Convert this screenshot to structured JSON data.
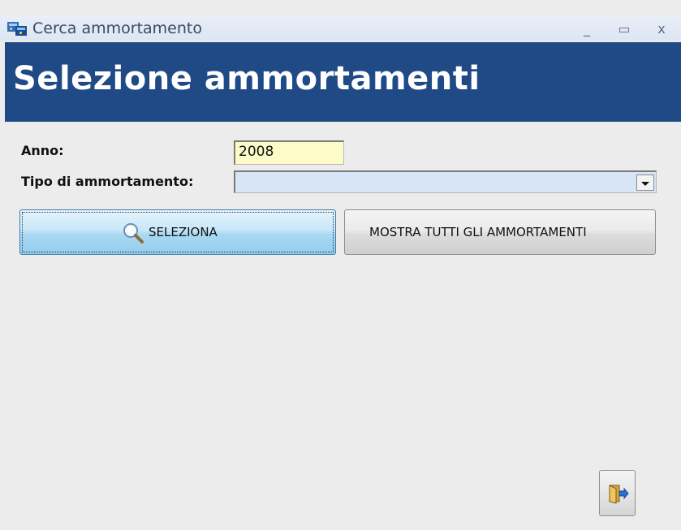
{
  "window": {
    "title": "Cerca ammortamento",
    "minimize_label": "_",
    "maximize_label": "▭",
    "close_label": "x"
  },
  "header": {
    "title": "Selezione ammortamenti"
  },
  "form": {
    "anno": {
      "label": "Anno:",
      "value": "2008"
    },
    "tipo": {
      "label": "Tipo di ammortamento:",
      "value": ""
    }
  },
  "buttons": {
    "seleziona": "SELEZIONA",
    "mostra_tutti": "MOSTRA TUTTI GLI AMMORTAMENTI"
  },
  "icons": {
    "app": "app-icon",
    "search": "search-icon",
    "exit": "exit-door-icon"
  },
  "colors": {
    "header_bg": "#1f4a86",
    "anno_input_bg": "#fdfbc8",
    "tipo_select_bg": "#d8e5f6"
  }
}
